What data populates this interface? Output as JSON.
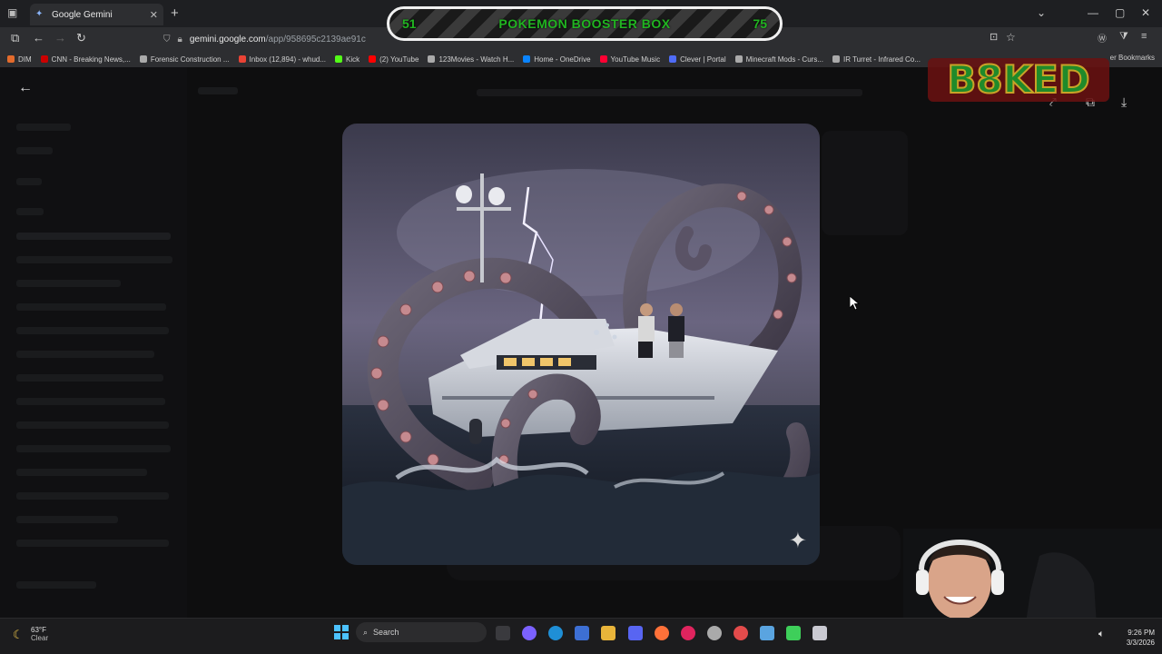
{
  "browser": {
    "tab_title": "Google Gemini",
    "url_host": "gemini.google.com",
    "url_path": "/app/958695c2139ae91c"
  },
  "bookmarks": [
    {
      "label": "DIM",
      "color": "#e36b2c"
    },
    {
      "label": "CNN - Breaking News,...",
      "color": "#cc0000"
    },
    {
      "label": "Forensic Construction ...",
      "color": "#aaaaaa"
    },
    {
      "label": "Inbox (12,894) - whud...",
      "color": "#ea4335"
    },
    {
      "label": "Kick",
      "color": "#53fc18"
    },
    {
      "label": "(2) YouTube",
      "color": "#ff0000"
    },
    {
      "label": "123Movies - Watch H...",
      "color": "#aaaaaa"
    },
    {
      "label": "Home - OneDrive",
      "color": "#0a84ff"
    },
    {
      "label": "YouTube Music",
      "color": "#ff0033"
    },
    {
      "label": "Clever | Portal",
      "color": "#4f6cf7"
    },
    {
      "label": "Minecraft Mods - Curs...",
      "color": "#aaaaaa"
    },
    {
      "label": "IR Turret - Infrared Co...",
      "color": "#aaaaaa"
    }
  ],
  "bookmarks_other": "er Bookmarks",
  "overlay": {
    "left_count": "51",
    "title": "POKEMON BOOSTER BOX",
    "right_count": "75",
    "logo_text": "B8KED"
  },
  "taskbar": {
    "weather_temp": "63°F",
    "weather_cond": "Clear",
    "search_label": "Search",
    "time": "9:26 PM",
    "date": "3/3/2026"
  },
  "colors": {
    "accent_green": "#21b421",
    "page_bg": "#0e0e0f"
  }
}
